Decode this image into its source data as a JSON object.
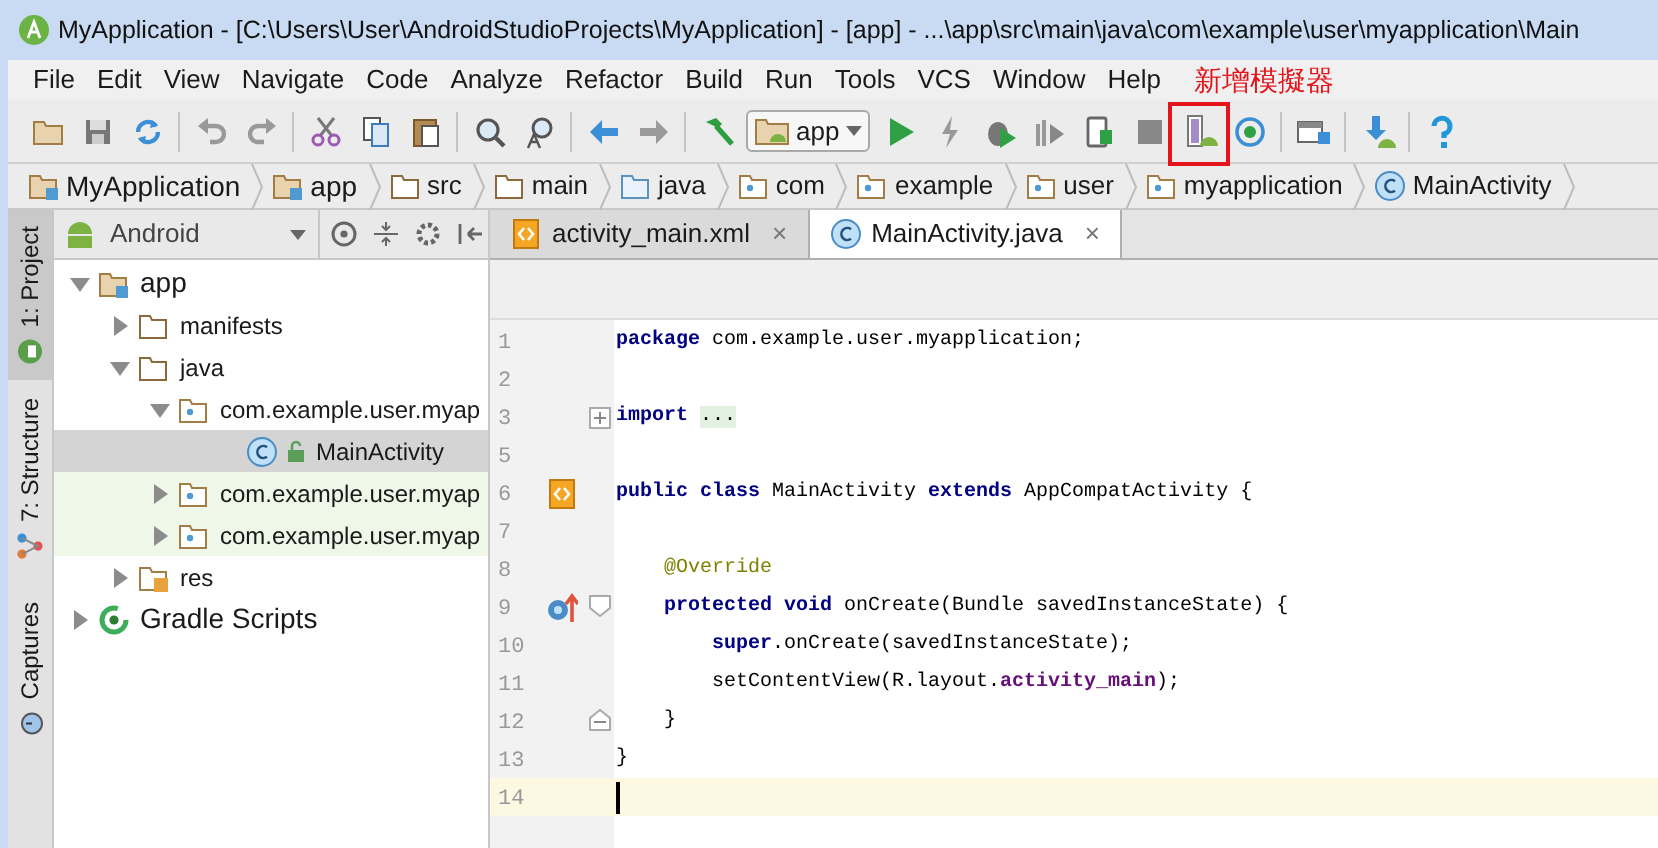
{
  "window": {
    "title": "MyApplication - [C:\\Users\\User\\AndroidStudioProjects\\MyApplication] - [app] - ...\\app\\src\\main\\java\\com\\example\\user\\myapplication\\Main"
  },
  "menu": [
    "File",
    "Edit",
    "View",
    "Navigate",
    "Code",
    "Analyze",
    "Refactor",
    "Build",
    "Run",
    "Tools",
    "VCS",
    "Window",
    "Help"
  ],
  "toolbar": {
    "run_config": "app"
  },
  "annotation": {
    "label": "新增模擬器"
  },
  "breadcrumbs": [
    {
      "label": "MyApplication",
      "kind": "module"
    },
    {
      "label": "app",
      "kind": "module"
    },
    {
      "label": "src",
      "kind": "folder"
    },
    {
      "label": "main",
      "kind": "folder"
    },
    {
      "label": "java",
      "kind": "source"
    },
    {
      "label": "com",
      "kind": "package"
    },
    {
      "label": "example",
      "kind": "package"
    },
    {
      "label": "user",
      "kind": "package"
    },
    {
      "label": "myapplication",
      "kind": "package"
    },
    {
      "label": "MainActivity",
      "kind": "class"
    }
  ],
  "tool_windows": [
    {
      "label": "1: Project",
      "selected": true
    },
    {
      "label": "7: Structure",
      "selected": false
    },
    {
      "label": "Captures",
      "selected": false
    }
  ],
  "project_panel": {
    "view": "Android",
    "tree": [
      {
        "label": "app",
        "kind": "module",
        "expanded": true,
        "selected": false,
        "highlighted": false,
        "children": [
          {
            "label": "manifests",
            "kind": "folder",
            "expanded": false,
            "selected": false,
            "highlighted": false
          },
          {
            "label": "java",
            "kind": "folder",
            "expanded": true,
            "selected": false,
            "highlighted": false,
            "children": [
              {
                "label": "com.example.user.myap",
                "kind": "package",
                "expanded": true,
                "selected": false,
                "highlighted": false,
                "children": [
                  {
                    "label": "MainActivity",
                    "kind": "class",
                    "selected": true,
                    "highlighted": false
                  }
                ]
              },
              {
                "label": "com.example.user.myap",
                "kind": "package",
                "expanded": false,
                "selected": false,
                "highlighted": true
              },
              {
                "label": "com.example.user.myap",
                "kind": "package",
                "expanded": false,
                "selected": false,
                "highlighted": true
              }
            ]
          },
          {
            "label": "res",
            "kind": "res",
            "expanded": false,
            "selected": false,
            "highlighted": false
          }
        ]
      },
      {
        "label": "Gradle Scripts",
        "kind": "gradle",
        "expanded": false,
        "selected": false,
        "highlighted": false
      }
    ]
  },
  "editor_tabs": [
    {
      "label": "activity_main.xml",
      "kind": "layout",
      "close": "×",
      "selected": false
    },
    {
      "label": "MainActivity.java",
      "kind": "class",
      "close": "×",
      "selected": true
    }
  ],
  "code": [
    {
      "number": "1",
      "current": false,
      "tokens": [
        {
          "kind": "keyword",
          "text": "package"
        },
        {
          "kind": "plain",
          "text": " com.example.user.myapplication;"
        }
      ]
    },
    {
      "number": "2",
      "current": false
    },
    {
      "number": "3",
      "current": false,
      "gutter": [
        {
          "kind": "fold_collapsed"
        }
      ],
      "tokens": [
        {
          "kind": "keyword",
          "text": "import"
        },
        {
          "kind": "folded",
          "text": "..."
        }
      ]
    },
    {
      "number": "5",
      "current": false
    },
    {
      "number": "6",
      "current": false,
      "gutter": [
        {
          "kind": "layout"
        }
      ],
      "tokens": [
        {
          "kind": "keyword",
          "text": "public class"
        },
        {
          "kind": "plain",
          "text": " MainActivity "
        },
        {
          "kind": "keyword",
          "text": "extends"
        },
        {
          "kind": "plain",
          "text": " AppCompatActivity {"
        }
      ]
    },
    {
      "number": "7",
      "current": false
    },
    {
      "number": "8",
      "current": false,
      "tokens": [
        {
          "kind": "annotation",
          "text": "    @Override"
        }
      ]
    },
    {
      "number": "9",
      "current": false,
      "gutter": [
        {
          "kind": "override"
        },
        {
          "kind": "fold_start"
        }
      ],
      "tokens": [
        {
          "kind": "keyword",
          "text": "    protected void"
        },
        {
          "kind": "plain",
          "text": " onCreate(Bundle savedInstanceState) {"
        }
      ]
    },
    {
      "number": "10",
      "current": false,
      "tokens": [
        {
          "kind": "keyword",
          "text": "        super"
        },
        {
          "kind": "plain",
          "text": ".onCreate(savedInstanceState);"
        }
      ]
    },
    {
      "number": "11",
      "current": false,
      "tokens": [
        {
          "kind": "plain",
          "text": "        setContentView(R.layout."
        },
        {
          "kind": "field",
          "text": "activity_main"
        },
        {
          "kind": "plain",
          "text": ");"
        }
      ]
    },
    {
      "number": "12",
      "current": false,
      "gutter": [
        {
          "kind": "fold_end"
        }
      ],
      "tokens": [
        {
          "kind": "plain",
          "text": "    }"
        }
      ]
    },
    {
      "number": "13",
      "current": false,
      "tokens": [
        {
          "kind": "plain",
          "text": "}"
        }
      ]
    },
    {
      "number": "14",
      "current": true
    }
  ]
}
